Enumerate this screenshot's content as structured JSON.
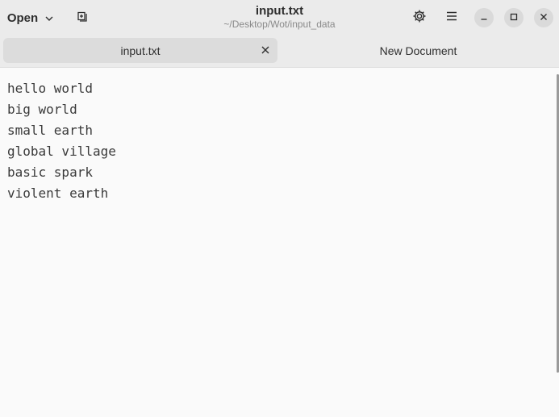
{
  "header": {
    "open_label": "Open",
    "open_icon": "chevron-down-icon",
    "new_tab_icon": "new-tab-icon",
    "title": "input.txt",
    "subtitle": "~/Desktop/Wot/input_data",
    "icons": [
      "gear-icon",
      "hamburger-menu-icon",
      "minimize-icon",
      "maximize-icon",
      "close-icon"
    ]
  },
  "tabs": [
    {
      "label": "input.txt",
      "active": true
    },
    {
      "label": "New Document",
      "active": false
    }
  ],
  "editor": {
    "lines": [
      "hello world",
      "big world",
      "small earth",
      "global village",
      "basic spark",
      "violent earth"
    ]
  },
  "colors": {
    "header_bg": "#ebebeb",
    "editor_bg": "#fafafa",
    "active_tab_bg": "#dcdcdc",
    "window_button_bg": "#dadada"
  }
}
